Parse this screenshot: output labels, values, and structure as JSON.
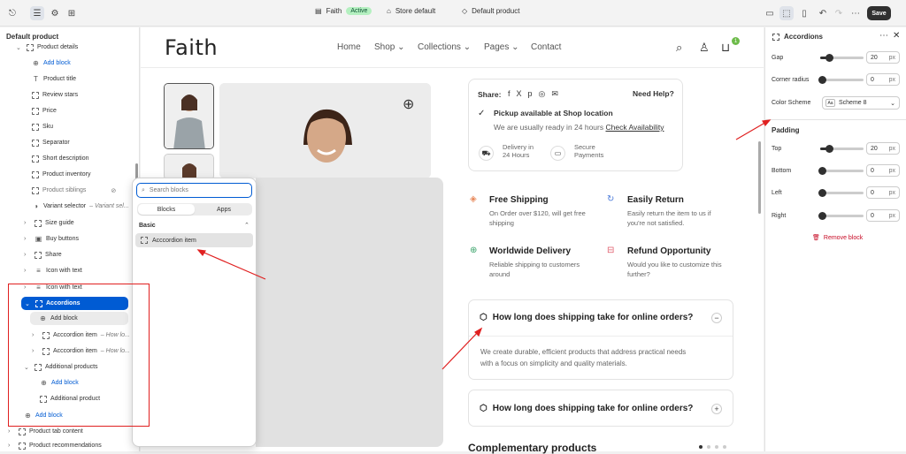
{
  "topbar": {
    "store_name": "Faith",
    "status": "Active",
    "store_default": "Store default",
    "product_default": "Default product",
    "save_label": "Save"
  },
  "left_panel": {
    "title": "Default product",
    "items": [
      {
        "label": "Product details"
      },
      {
        "label": "Add block"
      },
      {
        "label": "Product title"
      },
      {
        "label": "Review stars"
      },
      {
        "label": "Price"
      },
      {
        "label": "Sku"
      },
      {
        "label": "Separator"
      },
      {
        "label": "Short description"
      },
      {
        "label": "Product inventory"
      },
      {
        "label": "Product siblings"
      },
      {
        "label": "Variant selector",
        "sub": "– Variant sel..."
      },
      {
        "label": "Size guide"
      },
      {
        "label": "Buy buttons"
      },
      {
        "label": "Share"
      },
      {
        "label": "Icon with text"
      },
      {
        "label": "Icon with text"
      },
      {
        "label": "Accordions"
      },
      {
        "label": "Add block"
      },
      {
        "label": "Acccordion item",
        "sub": "– How lo..."
      },
      {
        "label": "Acccordion item",
        "sub": "– How lo..."
      },
      {
        "label": "Additional products"
      },
      {
        "label": "Add block"
      },
      {
        "label": "Additional product"
      },
      {
        "label": "Add block"
      },
      {
        "label": "Product tab content"
      },
      {
        "label": "Product recommendations"
      }
    ]
  },
  "popover": {
    "search_placeholder": "Search blocks",
    "tab_blocks": "Blocks",
    "tab_apps": "Apps",
    "section": "Basic",
    "item": "Acccordion item"
  },
  "preview": {
    "logo": "Faith",
    "nav": [
      "Home",
      "Shop",
      "Collections",
      "Pages",
      "Contact"
    ],
    "cart_count": "1",
    "share_label": "Share:",
    "need_help": "Need Help?",
    "pickup": "Pickup available at",
    "pickup_location": "Shop location",
    "ready": "We are usually ready in 24 hours",
    "check": "Check Availability",
    "delivery": "Delivery in",
    "delivery2": "24 Hours",
    "secure": "Secure",
    "secure2": "Payments",
    "features": [
      {
        "title": "Free Shipping",
        "desc1": "On Order over $120, will get free",
        "desc2": "shipping"
      },
      {
        "title": "Easily Return",
        "desc1": "Easily return the item to us if",
        "desc2": "you're not satisfied."
      },
      {
        "title": "Worldwide Delivery",
        "desc1": "Reliable shipping to customers",
        "desc2": "around"
      },
      {
        "title": "Refund Opportunity",
        "desc1": "Would you like to customize this",
        "desc2": "further?"
      }
    ],
    "faq1_q": "How long does shipping take for online orders?",
    "faq1_a1": "We create durable, efficient products that address practical needs",
    "faq1_a2": "with a focus on simplicity and quality materials.",
    "faq2_q": "How long does shipping take for online orders?",
    "complementary": "Complementary products"
  },
  "right_panel": {
    "title": "Accordions",
    "gap_label": "Gap",
    "gap_value": "20",
    "corner_label": "Corner radius",
    "corner_value": "0",
    "scheme_label": "Color Scheme",
    "scheme_value": "Scheme 8",
    "scheme_swatch": "Aa",
    "padding_title": "Padding",
    "top_label": "Top",
    "top_value": "20",
    "bottom_label": "Bottom",
    "bottom_value": "0",
    "left_label": "Left",
    "left_value": "0",
    "right_label": "Right",
    "right_value": "0",
    "unit": "px",
    "remove": "Remove block"
  },
  "colors": {
    "accent": "#005bd3",
    "annotation": "#e02020",
    "save": "#303030"
  }
}
